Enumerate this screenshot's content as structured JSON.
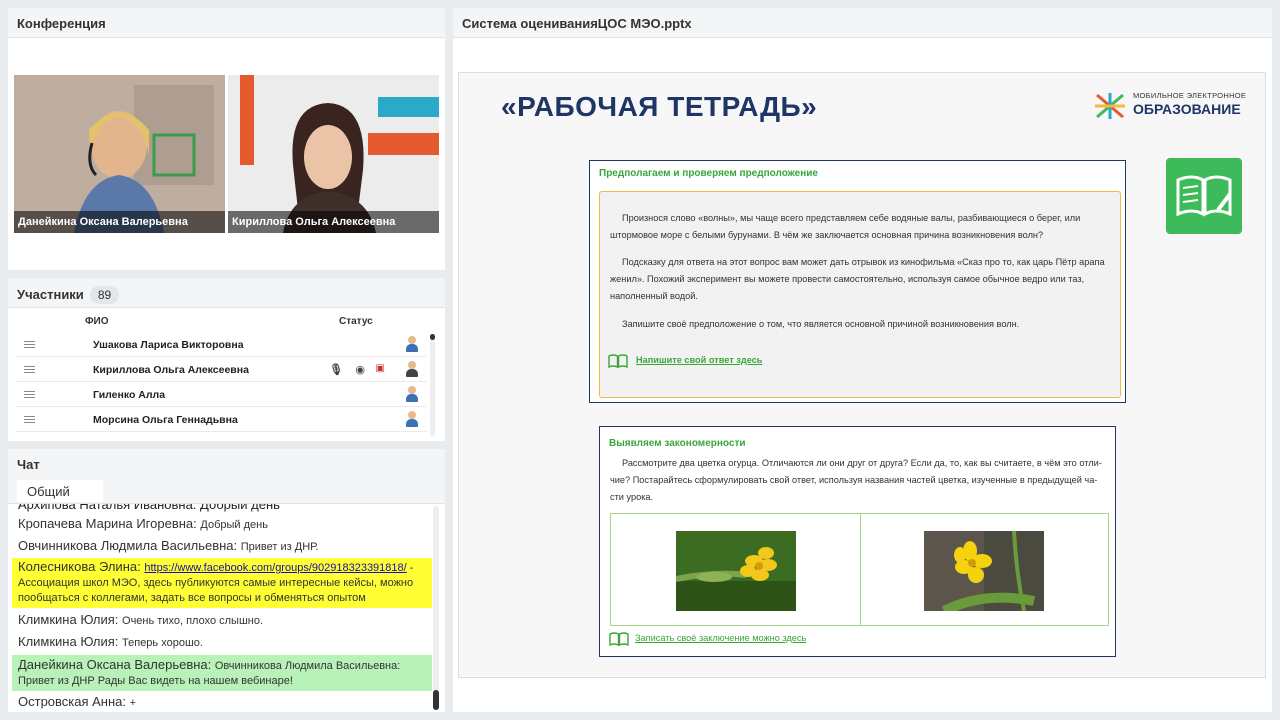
{
  "conference": {
    "title": "Конференция",
    "videos": [
      {
        "name": "Данейкина Оксана  Валерьевна"
      },
      {
        "name": "Кириллова Ольга Алексеевна"
      }
    ]
  },
  "participants": {
    "title": "Участники",
    "count": "89",
    "col_name": "ФИО",
    "col_status": "Статус",
    "rows": [
      {
        "name": "Ушакова Лариса Викторовна"
      },
      {
        "name": "Кириллова Ольга Алексеевна"
      },
      {
        "name": "Гиленко Алла"
      },
      {
        "name": "Морсина Ольга  Геннадьвна"
      }
    ]
  },
  "chat": {
    "title": "Чат",
    "tab": "Общий",
    "cut_top": "Архипова Наталья Ивановна: Добрый день",
    "messages": [
      {
        "author": "Кропачева Марина  Игоревна:",
        "text": "Добрый день"
      },
      {
        "author": "Овчинникова Людмила  Васильевна:",
        "text": "Привет из ДНР."
      },
      {
        "author": "Колесникова Элина:",
        "link": "https://www.facebook.com/groups/902918323391818/",
        "text": " - Ассоциация школ МЭО, здесь публикуются самые интересные кейсы, можно пообщаться с коллегами, задать все вопросы и обменяться опытом"
      },
      {
        "author": "Климкина Юлия:",
        "text": "Очень тихо, плохо слышно."
      },
      {
        "author": "Климкина Юлия:",
        "text": "Теперь хорошо."
      },
      {
        "author": "Данейкина Оксана  Валерьевна:",
        "text": "Овчинникова Людмила Васильевна: Привет из ДНР Рады Вас видеть на нашем вебинаре!"
      },
      {
        "author": "Островская Анна:",
        "text": "+"
      }
    ]
  },
  "presentation": {
    "title": "Система оцениванияЦОС МЭО.pptx",
    "slide_title": "«РАБОЧАЯ ТЕТРАДЬ»",
    "logo_line1": "МОБИЛЬНОЕ ЭЛЕКТРОННОЕ",
    "logo_line2": "ОБРАЗОВАНИЕ",
    "card1": {
      "title": "Предполагаем и проверяем предположение",
      "p1": "Произнося слово «волны», мы чаще всего представляем себе водяные валы, разбивающиеся о берег, или штормовое море с белыми бурунами. В чём же заключается основная причина возникновения волн?",
      "p2": "Подсказку для ответа на этот вопрос вам может дать отрывок из кинофильма «Сказ про то, как царь Пётр арапа женил». Похожий эксперимент вы можете провести самостоятельно, используя самое обычное ведро или таз, наполненный водой.",
      "p3": "Запишите своё предположение о том, что является основной причиной возникновения волн.",
      "link": "Напишите свой ответ здесь"
    },
    "card2": {
      "title": "Выявляем закономерности",
      "p1": "Рассмотрите два цветка огурца. Отличаются ли они друг от друга? Если да, то, как вы считаете, в чём это отли-чие? Постарайтесь сформулировать свой ответ, используя названия частей цветка, изученные в предыдущей ча-сти урока.",
      "link": "Записать своё заключение можно здесь"
    }
  }
}
